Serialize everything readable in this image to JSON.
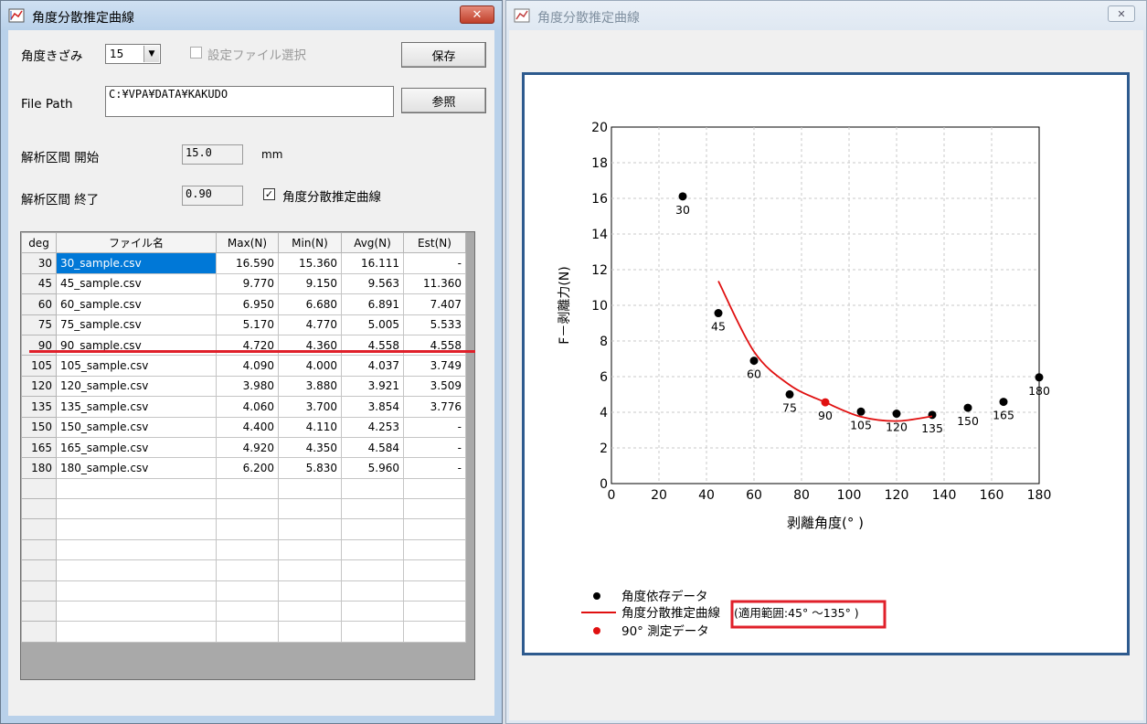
{
  "left_window": {
    "title": "角度分散推定曲線",
    "close_label": "✕",
    "angle_step_label": "角度きざみ",
    "angle_step_value": "15",
    "settings_file_label": "設定ファイル選択",
    "save_button": "保存",
    "file_path_label": "File  Path",
    "file_path_value": "C:¥VPA¥DATA¥KAKUDO",
    "browse_button": "参照",
    "range_start_label": "解析区間 開始",
    "range_start_value": "15.0",
    "range_start_unit": "mm",
    "range_end_label": "解析区間 終了",
    "range_end_value": "0.90",
    "curve_checkbox_label": "角度分散推定曲線",
    "curve_checkbox_mark": "✓",
    "table": {
      "headers": [
        "deg",
        "ファイル名",
        "Max(N)",
        "Min(N)",
        "Avg(N)",
        "Est(N)"
      ],
      "rows": [
        {
          "deg": "30",
          "file": "30_sample.csv",
          "max": "16.590",
          "min": "15.360",
          "avg": "16.111",
          "est": "-"
        },
        {
          "deg": "45",
          "file": "45_sample.csv",
          "max": "9.770",
          "min": "9.150",
          "avg": "9.563",
          "est": "11.360"
        },
        {
          "deg": "60",
          "file": "60_sample.csv",
          "max": "6.950",
          "min": "6.680",
          "avg": "6.891",
          "est": "7.407"
        },
        {
          "deg": "75",
          "file": "75_sample.csv",
          "max": "5.170",
          "min": "4.770",
          "avg": "5.005",
          "est": "5.533"
        },
        {
          "deg": "90",
          "file": "90_sample.csv",
          "max": "4.720",
          "min": "4.360",
          "avg": "4.558",
          "est": "4.558"
        },
        {
          "deg": "105",
          "file": "105_sample.csv",
          "max": "4.090",
          "min": "4.000",
          "avg": "4.037",
          "est": "3.749"
        },
        {
          "deg": "120",
          "file": "120_sample.csv",
          "max": "3.980",
          "min": "3.880",
          "avg": "3.921",
          "est": "3.509"
        },
        {
          "deg": "135",
          "file": "135_sample.csv",
          "max": "4.060",
          "min": "3.700",
          "avg": "3.854",
          "est": "3.776"
        },
        {
          "deg": "150",
          "file": "150_sample.csv",
          "max": "4.400",
          "min": "4.110",
          "avg": "4.253",
          "est": "-"
        },
        {
          "deg": "165",
          "file": "165_sample.csv",
          "max": "4.920",
          "min": "4.350",
          "avg": "4.584",
          "est": "-"
        },
        {
          "deg": "180",
          "file": "180_sample.csv",
          "max": "6.200",
          "min": "5.830",
          "avg": "5.960",
          "est": "-"
        }
      ]
    }
  },
  "right_window": {
    "title": "角度分散推定曲線",
    "close_label": "✕"
  },
  "chart_data": {
    "type": "scatter",
    "xlabel": "剥離角度(°  )",
    "ylabel": "F－剥離力(N)",
    "xlim": [
      0,
      180
    ],
    "ylim": [
      0,
      20
    ],
    "x_ticks": [
      0,
      20,
      40,
      60,
      80,
      100,
      120,
      140,
      160,
      180
    ],
    "y_ticks": [
      0,
      2,
      4,
      6,
      8,
      10,
      12,
      14,
      16,
      18,
      20
    ],
    "grid": true,
    "legend_position": "bottom-left",
    "series": [
      {
        "name": "角度依存データ",
        "kind": "points",
        "color": "#000000",
        "points": [
          {
            "x": 30,
            "y": 16.111,
            "label": "30"
          },
          {
            "x": 45,
            "y": 9.563,
            "label": "45"
          },
          {
            "x": 60,
            "y": 6.891,
            "label": "60"
          },
          {
            "x": 75,
            "y": 5.005,
            "label": "75"
          },
          {
            "x": 105,
            "y": 4.037,
            "label": "105"
          },
          {
            "x": 120,
            "y": 3.921,
            "label": "120"
          },
          {
            "x": 135,
            "y": 3.854,
            "label": "135"
          },
          {
            "x": 150,
            "y": 4.253,
            "label": "150"
          },
          {
            "x": 165,
            "y": 4.584,
            "label": "165"
          },
          {
            "x": 180,
            "y": 5.96,
            "label": "180"
          }
        ]
      },
      {
        "name": "角度分散推定曲線",
        "annotation": "(適用範囲:45°  ～135°  )",
        "kind": "curve",
        "color": "#e01010",
        "x": [
          45,
          60,
          75,
          90,
          105,
          120,
          135
        ],
        "y": [
          11.36,
          7.407,
          5.533,
          4.558,
          3.749,
          3.509,
          3.776
        ]
      },
      {
        "name": "90°  測定データ",
        "kind": "points",
        "color": "#e01010",
        "points": [
          {
            "x": 90,
            "y": 4.558,
            "label": "90"
          }
        ]
      }
    ]
  }
}
